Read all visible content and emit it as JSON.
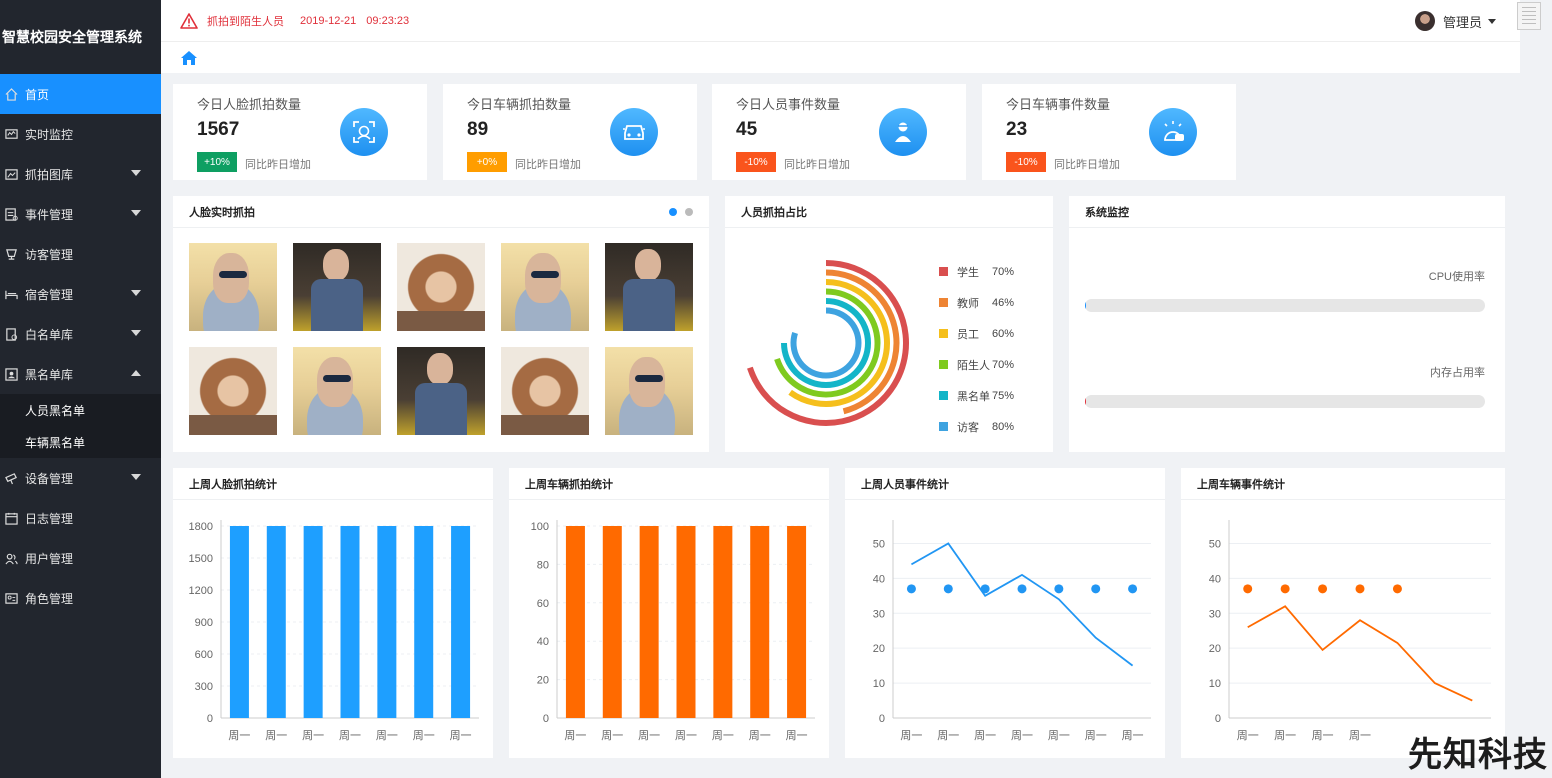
{
  "app": {
    "title": "智慧校园安全管理系统"
  },
  "sidebar": {
    "items": [
      {
        "label": "首页",
        "icon": "home-icon",
        "active": true
      },
      {
        "label": "实时监控",
        "icon": "monitor-icon"
      },
      {
        "label": "抓拍图库",
        "icon": "image-icon",
        "arrow": "down"
      },
      {
        "label": "事件管理",
        "icon": "event-icon",
        "arrow": "down"
      },
      {
        "label": "访客管理",
        "icon": "cup-icon"
      },
      {
        "label": "宿舍管理",
        "icon": "bed-icon",
        "arrow": "down"
      },
      {
        "label": "白名单库",
        "icon": "whitelist-icon",
        "arrow": "down"
      },
      {
        "label": "黑名单库",
        "icon": "blacklist-icon",
        "arrow": "up"
      },
      {
        "label": "设备管理",
        "icon": "device-icon",
        "arrow": "down"
      },
      {
        "label": "日志管理",
        "icon": "calendar-icon"
      },
      {
        "label": "用户管理",
        "icon": "users-icon"
      },
      {
        "label": "角色管理",
        "icon": "role-icon"
      }
    ],
    "blacklist_sub": [
      "人员黑名单",
      "车辆黑名单"
    ]
  },
  "header": {
    "alert_text": "抓拍到陌生人员",
    "alert_date": "2019-12-21",
    "alert_time": "09:23:23",
    "user_name": "管理员"
  },
  "stats": [
    {
      "title": "今日人脸抓拍数量",
      "value": "1567",
      "badge": "+10%",
      "badge_color": "#0e9f62",
      "compare": "同比昨日增加",
      "icon": "face-scan-icon"
    },
    {
      "title": "今日车辆抓拍数量",
      "value": "89",
      "badge": "+0%",
      "badge_color": "#ff9d00",
      "compare": "同比昨日增加",
      "icon": "car-icon"
    },
    {
      "title": "今日人员事件数量",
      "value": "45",
      "badge": "-10%",
      "badge_color": "#fa541c",
      "compare": "同比昨日增加",
      "icon": "person-alert-icon"
    },
    {
      "title": "今日车辆事件数量",
      "value": "23",
      "badge": "-10%",
      "badge_color": "#fa541c",
      "compare": "同比昨日增加",
      "icon": "car-alarm-icon"
    }
  ],
  "panels": {
    "face_capture": "人脸实时抓拍",
    "person_ratio": "人员抓拍占比",
    "system_monitor": "系统监控",
    "week_face": "上周人脸抓拍统计",
    "week_car": "上周车辆抓拍统计",
    "week_person_event": "上周人员事件统计",
    "week_car_event": "上周车辆事件统计"
  },
  "monitor": {
    "cpu_label": "CPU使用率",
    "cpu_value": 0.2,
    "cpu_color": "#1890ff",
    "mem_label": "内存占用率",
    "mem_value": 0.2,
    "mem_color": "#e0303a"
  },
  "ratio": {
    "items": [
      {
        "name": "学生",
        "pct": "70%",
        "value": 70,
        "color": "#d94f4f"
      },
      {
        "name": "教师",
        "pct": "46%",
        "value": 46,
        "color": "#ee8433"
      },
      {
        "name": "员工",
        "pct": "60%",
        "value": 60,
        "color": "#f5bf1c"
      },
      {
        "name": "陌生人",
        "pct": "70%",
        "value": 70,
        "color": "#7fca1f"
      },
      {
        "name": "黑名单",
        "pct": "75%",
        "value": 75,
        "color": "#13b5c8"
      },
      {
        "name": "访客",
        "pct": "80%",
        "value": 80,
        "color": "#3ea3e0"
      }
    ]
  },
  "chart_data": [
    {
      "type": "bar",
      "categories": [
        "周一",
        "周一",
        "周一",
        "周一",
        "周一",
        "周一",
        "周一"
      ],
      "values": [
        1800,
        1800,
        1800,
        1800,
        1800,
        1800,
        1800
      ],
      "yticks": [
        0,
        300,
        600,
        900,
        1200,
        1500,
        1800
      ],
      "ylim": [
        0,
        1800
      ],
      "color": "#1e9fff"
    },
    {
      "type": "bar",
      "categories": [
        "周一",
        "周一",
        "周一",
        "周一",
        "周一",
        "周一",
        "周一"
      ],
      "values": [
        100,
        100,
        100,
        100,
        100,
        100,
        100
      ],
      "yticks": [
        0,
        20,
        40,
        60,
        80,
        100
      ],
      "ylim": [
        0,
        100
      ],
      "color": "#ff6a00"
    },
    {
      "type": "line",
      "categories": [
        "周一",
        "周一",
        "周一",
        "周一",
        "周一",
        "周一",
        "周一"
      ],
      "series": [
        {
          "kind": "line",
          "values": [
            44,
            50,
            35,
            41,
            34,
            23,
            15
          ]
        },
        {
          "kind": "scatter",
          "values": [
            37,
            37,
            37,
            37,
            37,
            37,
            37
          ]
        }
      ],
      "yticks": [
        0,
        10,
        20,
        30,
        40,
        50
      ],
      "ylim": [
        0,
        55
      ],
      "color": "#2196f3"
    },
    {
      "type": "line",
      "categories": [
        "周一",
        "周一",
        "周一",
        "周一"
      ],
      "series": [
        {
          "kind": "line",
          "values": [
            26,
            32,
            19.5,
            28,
            21.5,
            10,
            5
          ]
        },
        {
          "kind": "scatter",
          "values": [
            37,
            37,
            37,
            37,
            37
          ]
        }
      ],
      "yticks": [
        0,
        10,
        20,
        30,
        40,
        50
      ],
      "ylim": [
        0,
        55
      ],
      "color": "#ff6a00"
    }
  ],
  "footer": {
    "watermark": "先知科技"
  }
}
